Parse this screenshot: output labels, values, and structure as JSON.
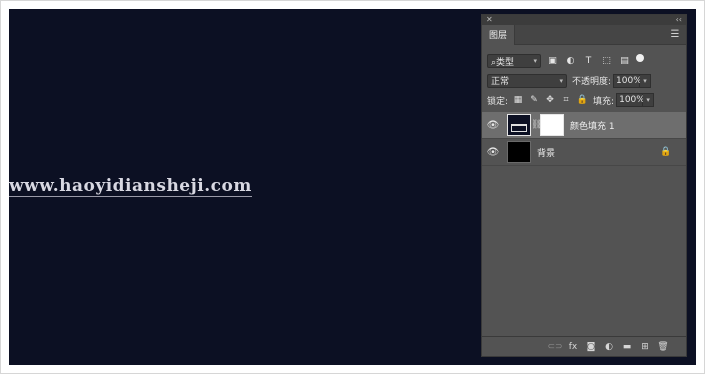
{
  "canvas": {
    "background": "#0c1023"
  },
  "watermark": {
    "text": "www.haoyidiansheji.com"
  },
  "panel": {
    "topbar": {
      "left": "✕",
      "right": "‹‹"
    },
    "tab_label": "图层",
    "menu_icon": "☰",
    "filter": {
      "label": "⌕类型",
      "icons": {
        "image": "▣",
        "adjustment": "◐",
        "type": "T",
        "shape": "⬚",
        "smart": "▤"
      }
    },
    "blend": {
      "mode": "正常",
      "opacity_label": "不透明度:",
      "opacity_value": "100%"
    },
    "lock": {
      "label": "锁定:",
      "icons": {
        "pixels": "▦",
        "paint": "✎",
        "move": "✥",
        "artboard": "⌗",
        "all": "🔒"
      },
      "fill_label": "填充:",
      "fill_value": "100%"
    },
    "layers": [
      {
        "name": "颜色填充 1",
        "selected": true
      },
      {
        "name": "背景",
        "selected": false,
        "locked_icon": "🔒"
      }
    ],
    "footer_icons": {
      "link": "⊂⊃",
      "fx": "fx",
      "mask": "◙",
      "adjust": "◐",
      "group": "▬",
      "new": "⊞",
      "delete": "🗑"
    }
  },
  "colors": {
    "panel": "#535353",
    "selected_row": "#6e6e6e"
  }
}
